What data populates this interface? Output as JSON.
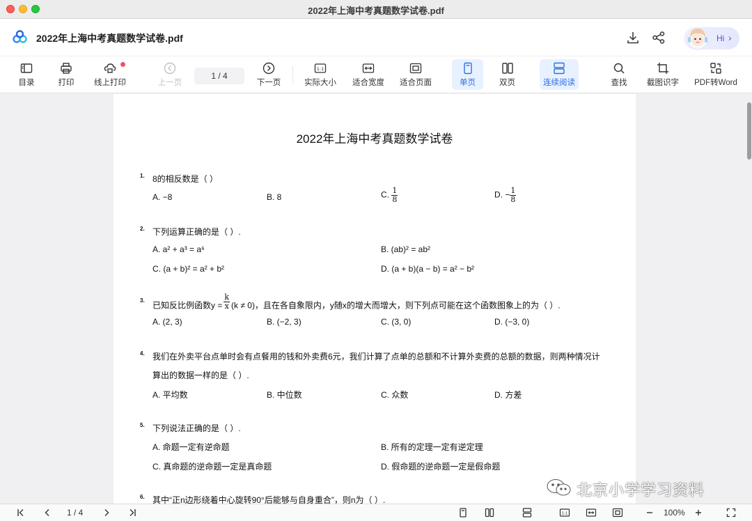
{
  "window": {
    "title": "2022年上海中考真题数学试卷.pdf"
  },
  "header": {
    "doc_title": "2022年上海中考真题数学试卷.pdf",
    "assistant_label": "Hi"
  },
  "toolbar": {
    "toc": "目录",
    "print": "打印",
    "online_print": "线上打印",
    "prev": "上一页",
    "page_indicator": "1 / 4",
    "next": "下一页",
    "actual_size": "实际大小",
    "fit_width": "适合宽度",
    "fit_page": "适合页面",
    "single": "单页",
    "double": "双页",
    "continuous": "连续阅读",
    "find": "查找",
    "ocr": "截图识字",
    "to_word": "PDF转Word"
  },
  "paper": {
    "title": "2022年上海中考真题数学试卷",
    "questions": [
      {
        "num": "1.",
        "text": "8的相反数是（  ）",
        "options": [
          "A. −8",
          "B. 8",
          "C. ",
          "D. −"
        ]
      },
      {
        "num": "2.",
        "text": "下列运算正确的是（  ）.",
        "options": [
          "A. a² + a³ = a⁶",
          "B. (ab)² = ab²",
          "C. (a + b)² = a² + b²",
          "D. (a + b)(a − b) = a² − b²"
        ]
      },
      {
        "num": "3.",
        "text_pre": "已知反比例函数y =",
        "text_post": "(k ≠ 0)，且在各自象限内，y随x的增大而增大，则下列点可能在这个函数图象上的为（  ）.",
        "options": [
          "A. (2, 3)",
          "B. (−2, 3)",
          "C. (3, 0)",
          "D. (−3, 0)"
        ]
      },
      {
        "num": "4.",
        "text": "我们在外卖平台点单时会有点餐用的钱和外卖费6元，我们计算了点单的总额和不计算外卖费的总额的数据，则两种情况计",
        "text2": "算出的数据一样的是（  ）.",
        "options": [
          "A. 平均数",
          "B. 中位数",
          "C. 众数",
          "D. 方差"
        ]
      },
      {
        "num": "5.",
        "text": "下列说法正确的是（  ）.",
        "options": [
          "A. 命题一定有逆命题",
          "B. 所有的定理一定有逆定理",
          "C. 真命题的逆命题一定是真命题",
          "D. 假命题的逆命题一定是假命题"
        ]
      },
      {
        "num": "6.",
        "text": "其中“正n边形绕着中心旋转90°后能够与自身重合”，则n为（  ）."
      }
    ],
    "fractions": {
      "one": "1",
      "eight": "8",
      "k": "k",
      "x": "x"
    }
  },
  "watermark": "北京小学学习资料",
  "statusbar": {
    "page_indicator": "1 / 4",
    "zoom": "100%"
  },
  "colors": {
    "accent": "#2f6fe6",
    "active_bg": "#e8f1ff",
    "badge": "#f0506e"
  }
}
